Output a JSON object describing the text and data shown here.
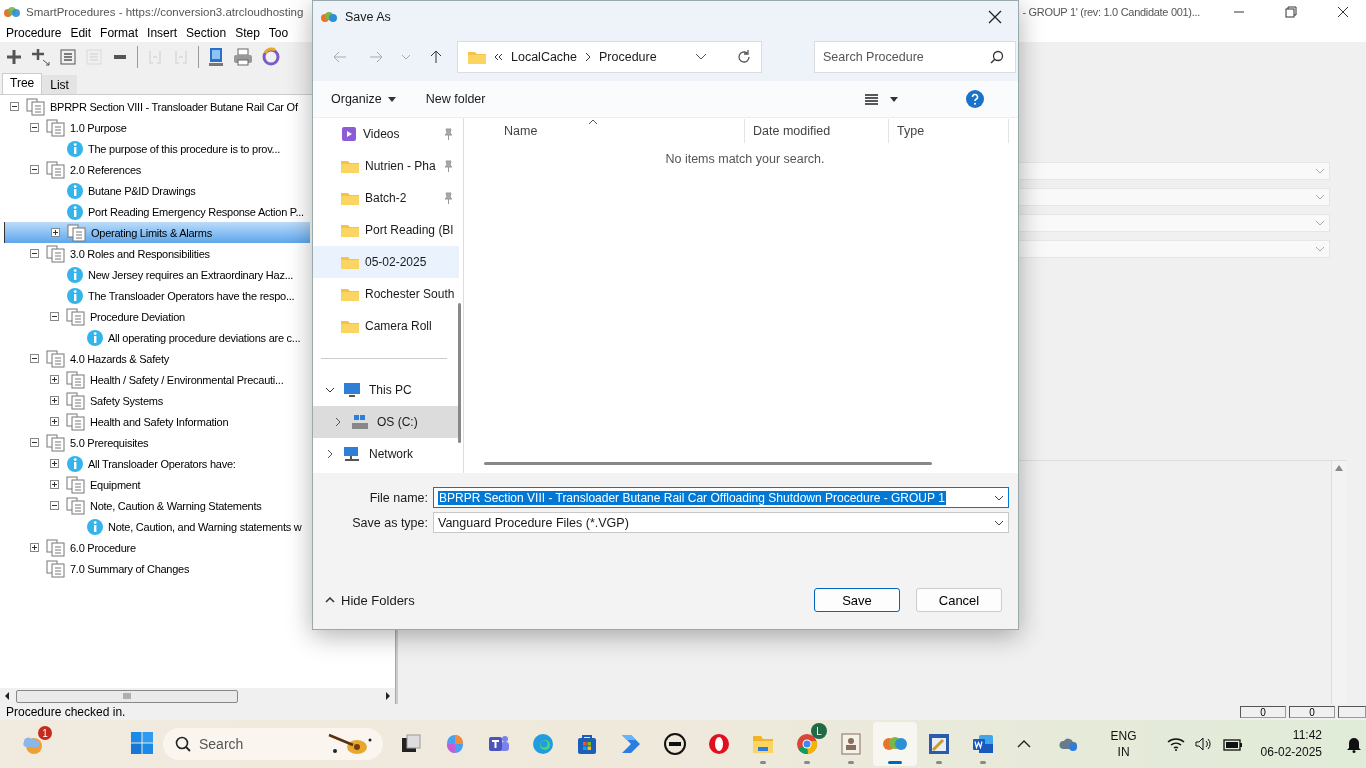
{
  "app": {
    "title": "SmartProcedures - https://conversion3.atrcloudhosting",
    "title_tail": "- GROUP 1' (rev: 1.0 Candidate 001)...",
    "menu": [
      "Procedure",
      "Edit",
      "Format",
      "Insert",
      "Section",
      "Step",
      "Too"
    ],
    "toolbar": [
      {
        "kind": "add",
        "disabled": false
      },
      {
        "kind": "add-child",
        "disabled": false
      },
      {
        "kind": "list",
        "disabled": false
      },
      {
        "kind": "list",
        "disabled": true
      },
      {
        "kind": "dash",
        "disabled": false
      },
      {
        "kind": "bracket",
        "disabled": true
      },
      {
        "kind": "bracket",
        "disabled": true
      },
      {
        "kind": "monitor",
        "disabled": false
      },
      {
        "kind": "printer",
        "disabled": false
      },
      {
        "kind": "ring",
        "disabled": false
      }
    ],
    "tabs": [
      {
        "label": "Tree",
        "selected": true
      },
      {
        "label": "List",
        "selected": false
      }
    ],
    "tree": [
      {
        "label": "BPRPR Section VIII - Transloader Butane Rail Car Of",
        "kind": "section",
        "expandable": true,
        "expanded": true,
        "selected": false,
        "children": [
          {
            "label": "1.0 Purpose",
            "kind": "section",
            "expandable": true,
            "expanded": true,
            "selected": false,
            "children": [
              {
                "label": "The purpose of this procedure is to prov...",
                "kind": "info",
                "expandable": false,
                "selected": false
              }
            ]
          },
          {
            "label": "2.0 References",
            "kind": "section",
            "expandable": true,
            "expanded": true,
            "selected": false,
            "children": [
              {
                "label": "Butane P&ID Drawings",
                "kind": "info",
                "expandable": false,
                "selected": false
              },
              {
                "label": "Port Reading Emergency Response Action P...",
                "kind": "info",
                "expandable": false,
                "selected": false
              },
              {
                "label": "Operating Limits & Alarms",
                "kind": "section",
                "expandable": true,
                "expanded": false,
                "selected": true
              }
            ]
          },
          {
            "label": "3.0 Roles and Responsibilities",
            "kind": "section",
            "expandable": true,
            "expanded": true,
            "selected": false,
            "children": [
              {
                "label": "New Jersey requires an Extraordinary Haz...",
                "kind": "info",
                "expandable": false,
                "selected": false
              },
              {
                "label": "The Transloader Operators have the respo...",
                "kind": "info",
                "expandable": false,
                "selected": false
              },
              {
                "label": "Procedure Deviation",
                "kind": "section",
                "expandable": true,
                "expanded": true,
                "selected": false,
                "children": [
                  {
                    "label": "All operating procedure deviations are c...",
                    "kind": "info",
                    "expandable": false,
                    "selected": false
                  }
                ]
              }
            ]
          },
          {
            "label": "4.0 Hazards & Safety",
            "kind": "section",
            "expandable": true,
            "expanded": true,
            "selected": false,
            "children": [
              {
                "label": "Health / Safety / Environmental Precauti...",
                "kind": "section",
                "expandable": true,
                "expanded": false,
                "selected": false
              },
              {
                "label": "Safety Systems",
                "kind": "section",
                "expandable": true,
                "expanded": false,
                "selected": false
              },
              {
                "label": "Health and Safety Information",
                "kind": "section",
                "expandable": true,
                "expanded": false,
                "selected": false
              }
            ]
          },
          {
            "label": "5.0 Prerequisites",
            "kind": "section",
            "expandable": true,
            "expanded": true,
            "selected": false,
            "children": [
              {
                "label": "All Transloader Operators have:",
                "kind": "info",
                "expandable": true,
                "expanded": false,
                "selected": false
              },
              {
                "label": "Equipment",
                "kind": "section",
                "expandable": true,
                "expanded": false,
                "selected": false
              },
              {
                "label": "Note, Caution & Warning Statements",
                "kind": "section",
                "expandable": true,
                "expanded": true,
                "selected": false,
                "children": [
                  {
                    "label": "Note, Caution, and Warning statements w",
                    "kind": "info",
                    "expandable": false,
                    "selected": false
                  }
                ]
              }
            ]
          },
          {
            "label": "6.0 Procedure",
            "kind": "section",
            "expandable": true,
            "expanded": false,
            "selected": false
          },
          {
            "label": "7.0 Summary of Changes",
            "kind": "section",
            "expandable": false,
            "selected": false
          }
        ]
      }
    ],
    "status": "Procedure checked in.",
    "status_panels": [
      "0",
      "0"
    ]
  },
  "dialog": {
    "title": "Save As",
    "path": [
      "LocalCache",
      "Procedure"
    ],
    "search_placeholder": "Search Procedure",
    "toolbar": [
      "Organize",
      "New folder"
    ],
    "nav": [
      {
        "label": "Videos",
        "kind": "videos",
        "pinned": true,
        "selected": false
      },
      {
        "label": "Nutrien - Pha",
        "kind": "folder",
        "pinned": true,
        "selected": false
      },
      {
        "label": "Batch-2",
        "kind": "folder",
        "pinned": true,
        "selected": false
      },
      {
        "label": "Port Reading (Bl",
        "kind": "folder",
        "pinned": false,
        "selected": false
      },
      {
        "label": "05-02-2025",
        "kind": "folder",
        "pinned": false,
        "selected": true
      },
      {
        "label": "Rochester South",
        "kind": "folder",
        "pinned": false,
        "selected": false
      },
      {
        "label": "Camera Roll",
        "kind": "folder",
        "pinned": false,
        "selected": false
      }
    ],
    "locations": [
      {
        "label": "This PC",
        "kind": "pc",
        "expanded": true,
        "selected": false,
        "children": [
          {
            "label": "OS (C:)",
            "kind": "drive",
            "expanded": false,
            "selected": true
          }
        ]
      },
      {
        "label": "Network",
        "kind": "network",
        "expanded": false,
        "selected": false
      }
    ],
    "columns": [
      "Name",
      "Date modified",
      "Type"
    ],
    "empty_message": "No items match your search.",
    "file_name_label": "File name:",
    "file_name": "BPRPR Section VIII - Transloader Butane Rail Car Offloading Shutdown Procedure - GROUP 1",
    "type_label": "Save as type:",
    "file_type": "Vanguard Procedure Files (*.VGP)",
    "hide_folders": "Hide Folders",
    "buttons": [
      "Save",
      "Cancel"
    ]
  },
  "taskbar": {
    "weather_badge": "1",
    "search": "Search",
    "apps": [
      {
        "kind": "task-view",
        "running": false,
        "selected": false
      },
      {
        "kind": "copilot",
        "running": false,
        "selected": false
      },
      {
        "kind": "teams",
        "running": false,
        "selected": false
      },
      {
        "kind": "edge",
        "running": false,
        "selected": false
      },
      {
        "kind": "store",
        "running": false,
        "selected": false
      },
      {
        "kind": "automate",
        "running": false,
        "selected": false
      },
      {
        "kind": "dell",
        "running": false,
        "selected": false
      },
      {
        "kind": "opera",
        "running": false,
        "selected": false
      },
      {
        "kind": "explorer",
        "running": true,
        "selected": false
      },
      {
        "kind": "chrome",
        "running": true,
        "selected": false,
        "badge": "L"
      },
      {
        "kind": "viewer",
        "running": true,
        "selected": false
      },
      {
        "kind": "smartprocedures",
        "running": true,
        "selected": true
      },
      {
        "kind": "editor",
        "running": true,
        "selected": false
      },
      {
        "kind": "word",
        "running": true,
        "selected": false
      }
    ],
    "lang": "ENG",
    "region": "IN",
    "time": "11:42",
    "date": "06-02-2025"
  }
}
